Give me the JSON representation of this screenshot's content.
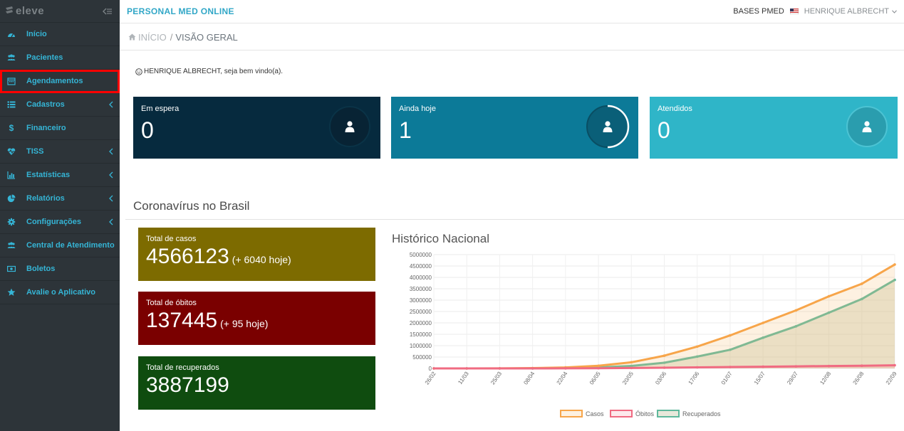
{
  "sidebar": {
    "logo": "eleve",
    "items": [
      {
        "label": "Início",
        "icon": "dashboard-icon",
        "submenu": false
      },
      {
        "label": "Pacientes",
        "icon": "users-icon",
        "submenu": false
      },
      {
        "label": "Agendamentos",
        "icon": "calendar-icon",
        "submenu": false,
        "highlighted": true
      },
      {
        "label": "Cadastros",
        "icon": "list-icon",
        "submenu": true
      },
      {
        "label": "Financeiro",
        "icon": "dollar-icon",
        "submenu": false
      },
      {
        "label": "TISS",
        "icon": "heartbeat-icon",
        "submenu": true
      },
      {
        "label": "Estatísticas",
        "icon": "bar-chart-icon",
        "submenu": true
      },
      {
        "label": "Relatórios",
        "icon": "pie-chart-icon",
        "submenu": true
      },
      {
        "label": "Configurações",
        "icon": "gear-icon",
        "submenu": true
      },
      {
        "label": "Central de Atendimento",
        "icon": "users-icon",
        "submenu": false
      },
      {
        "label": "Boletos",
        "icon": "money-icon",
        "submenu": false
      },
      {
        "label": "Avalie o Aplicativo",
        "icon": "star-icon",
        "submenu": false
      }
    ]
  },
  "header": {
    "brand": "PERSONAL MED ONLINE",
    "bases": "BASES PMED",
    "user": "HENRIQUE ALBRECHT"
  },
  "breadcrumb": {
    "home": "INÍCIO",
    "separator": "/",
    "current": "VISÃO GERAL"
  },
  "welcome": "HENRIQUE ALBRECHT, seja bem vindo(a).",
  "cards": [
    {
      "label": "Em espera",
      "value": "0",
      "color": "#062a3e"
    },
    {
      "label": "Ainda hoje",
      "value": "1",
      "color": "#0c7a98"
    },
    {
      "label": "Atendidos",
      "value": "0",
      "color": "#2fb5c8"
    }
  ],
  "corona": {
    "title": "Coronavírus no Brasil",
    "boxes": [
      {
        "label": "Total de casos",
        "value": "4566123",
        "delta": "(+ 6040 hoje)",
        "color": "#7d6b00"
      },
      {
        "label": "Total de óbitos",
        "value": "137445",
        "delta": "(+ 95 hoje)",
        "color": "#7a0000"
      },
      {
        "label": "Total de recuperados",
        "value": "3887199",
        "delta": "",
        "color": "#0f4c0f"
      }
    ]
  },
  "chart_data": {
    "type": "line",
    "title": "Histórico Nacional",
    "x": [
      "26/02",
      "11/03",
      "25/03",
      "08/04",
      "22/04",
      "06/05",
      "20/05",
      "03/06",
      "17/06",
      "01/07",
      "15/07",
      "29/07",
      "12/08",
      "26/08",
      "22/09"
    ],
    "ylim": [
      0,
      5000000
    ],
    "yticks": [
      "5000000",
      "4500000",
      "4000000",
      "3500000",
      "3000000",
      "2500000",
      "2000000",
      "1500000",
      "1000000",
      "500000",
      "0"
    ],
    "grid": true,
    "legend": "bottom",
    "series": [
      {
        "name": "Casos",
        "color": "#f7a54a",
        "fill": "rgba(247,190,120,0.22)",
        "values": [
          0,
          50,
          2500,
          15000,
          45000,
          115000,
          270000,
          560000,
          960000,
          1450000,
          2000000,
          2550000,
          3170000,
          3720000,
          4566123
        ]
      },
      {
        "name": "Óbitos",
        "color": "#f06b82",
        "fill": "rgba(240,107,130,0.15)",
        "values": [
          0,
          0,
          60,
          900,
          3000,
          8000,
          18000,
          32000,
          47000,
          61000,
          76000,
          90000,
          105000,
          118000,
          137445
        ]
      },
      {
        "name": "Recuperados",
        "color": "#5fb89c",
        "fill": "rgba(190,190,150,0.35)",
        "values": [
          0,
          0,
          0,
          1500,
          20000,
          45000,
          110000,
          250000,
          520000,
          820000,
          1350000,
          1850000,
          2450000,
          3050000,
          3887199
        ]
      }
    ]
  }
}
